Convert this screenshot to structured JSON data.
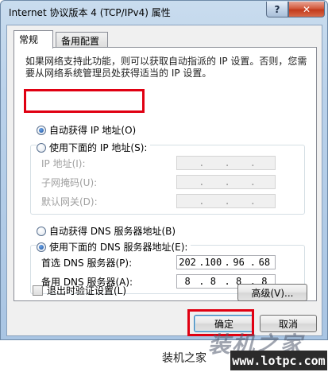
{
  "window": {
    "title": "Internet 协议版本 4 (TCP/IPv4) 属性",
    "help_label": "?",
    "close_label": "✕"
  },
  "tabs": [
    {
      "label": "常规",
      "active": true
    },
    {
      "label": "备用配置",
      "active": false
    }
  ],
  "intro_text": "如果网络支持此功能，则可以获取自动指派的 IP 设置。否则，您需要从网络系统管理员处获得适当的 IP 设置。",
  "ip_mode": {
    "auto_label": "自动获得 IP 地址(O)",
    "manual_label": "使用下面的 IP 地址(S):",
    "selected": "auto"
  },
  "ip_fields": [
    {
      "label": "IP 地址(I):",
      "octets": [
        "",
        "",
        "",
        ""
      ]
    },
    {
      "label": "子网掩码(U):",
      "octets": [
        "",
        "",
        "",
        ""
      ]
    },
    {
      "label": "默认网关(D):",
      "octets": [
        "",
        "",
        "",
        ""
      ]
    }
  ],
  "dns_mode": {
    "auto_label": "自动获得 DNS 服务器地址(B)",
    "manual_label": "使用下面的 DNS 服务器地址(E):",
    "selected": "manual"
  },
  "dns_fields": [
    {
      "label": "首选 DNS 服务器(P):",
      "octets": [
        "202",
        "100",
        "96",
        "68"
      ]
    },
    {
      "label": "备用 DNS 服务器(A):",
      "octets": [
        "8",
        "8",
        "8",
        "8"
      ]
    }
  ],
  "validate_on_exit_label": "退出时验证设置(L)",
  "advanced_button_label": "高级(V)...",
  "ok_button_label": "确定",
  "cancel_button_label": "取消",
  "footer": {
    "site_name": "装机之家",
    "logo_text": "装机之家",
    "url": "www.lotpc.com"
  },
  "colors": {
    "highlight": "#e00012",
    "titlebar": "#b9d1ea",
    "close_button": "#c23a1c"
  }
}
